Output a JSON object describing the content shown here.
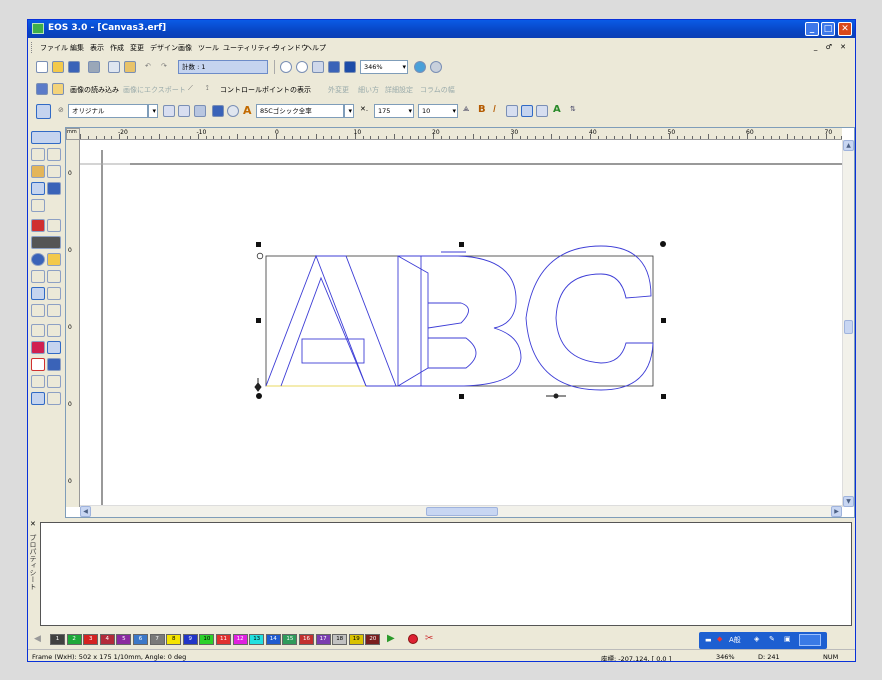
{
  "window": {
    "title": "EOS 3.0 - [Canvas3.erf]",
    "controls": {
      "minimize": "_",
      "maximize": "□",
      "close": "✕"
    },
    "mdi_controls": "_ ♂ ✕"
  },
  "menu": [
    "ファイル",
    "編集",
    "表示",
    "作成",
    "変更",
    "デザイン",
    "画像",
    "ツール",
    "ユーティリティー",
    "ウィンドウ",
    "ヘルプ"
  ],
  "toolbar1": {
    "object_count": "計数 : 1",
    "zoom": "346%"
  },
  "toolbar2": {
    "import_image": "画像の読み込み",
    "export_image": "画像にエクスポート",
    "show_control_points": "コントロールポイントの表示",
    "disabled_items": [
      "外変更",
      "細い方",
      "詳細設定",
      "コラムの幅"
    ]
  },
  "toolbar3": {
    "style": "オリジナル",
    "font": "85Cゴシック全率",
    "size_a": "175",
    "size_b": "10"
  },
  "ruler": {
    "corner": "mm",
    "h_labels": [
      "-20",
      "-10",
      "0",
      "10",
      "20",
      "30",
      "40",
      "50",
      "60",
      "70"
    ],
    "v_labels": [
      "0",
      "0",
      "0",
      "0",
      "0"
    ]
  },
  "canvas": {
    "text": "ABC",
    "outline_color": "#3d3dd6",
    "frame_color": "#333333"
  },
  "panel": {
    "label": "プロパティシート",
    "close": "✕"
  },
  "palette": {
    "cells": [
      {
        "n": "1",
        "c": "#404040"
      },
      {
        "n": "2",
        "c": "#1ea83a"
      },
      {
        "n": "3",
        "c": "#d42222"
      },
      {
        "n": "4",
        "c": "#b22a3a"
      },
      {
        "n": "5",
        "c": "#8a2aa0"
      },
      {
        "n": "6",
        "c": "#3c78c8"
      },
      {
        "n": "7",
        "c": "#7a7a7a"
      },
      {
        "n": "8",
        "c": "#f5e400"
      },
      {
        "n": "9",
        "c": "#2235c8"
      },
      {
        "n": "10",
        "c": "#2bd12b"
      },
      {
        "n": "11",
        "c": "#e03030"
      },
      {
        "n": "12",
        "c": "#e020e0"
      },
      {
        "n": "13",
        "c": "#22e0e0"
      },
      {
        "n": "14",
        "c": "#1f5bd0"
      },
      {
        "n": "15",
        "c": "#2f9b5b"
      },
      {
        "n": "16",
        "c": "#c23030"
      },
      {
        "n": "17",
        "c": "#7a3db0"
      },
      {
        "n": "18",
        "c": "#c2c2c2"
      },
      {
        "n": "19",
        "c": "#d9c200"
      },
      {
        "n": "20",
        "c": "#7a1e1e"
      }
    ]
  },
  "status": {
    "frame": "Frame (WxH): 502 x 175 1/10mm, Angle: 0 deg",
    "coords": "座標: -207.124, [ 0,0 ]",
    "zoom": "346%",
    "value": "D: 241",
    "mode": "NUM"
  },
  "language_bar": {
    "label": "A般"
  }
}
